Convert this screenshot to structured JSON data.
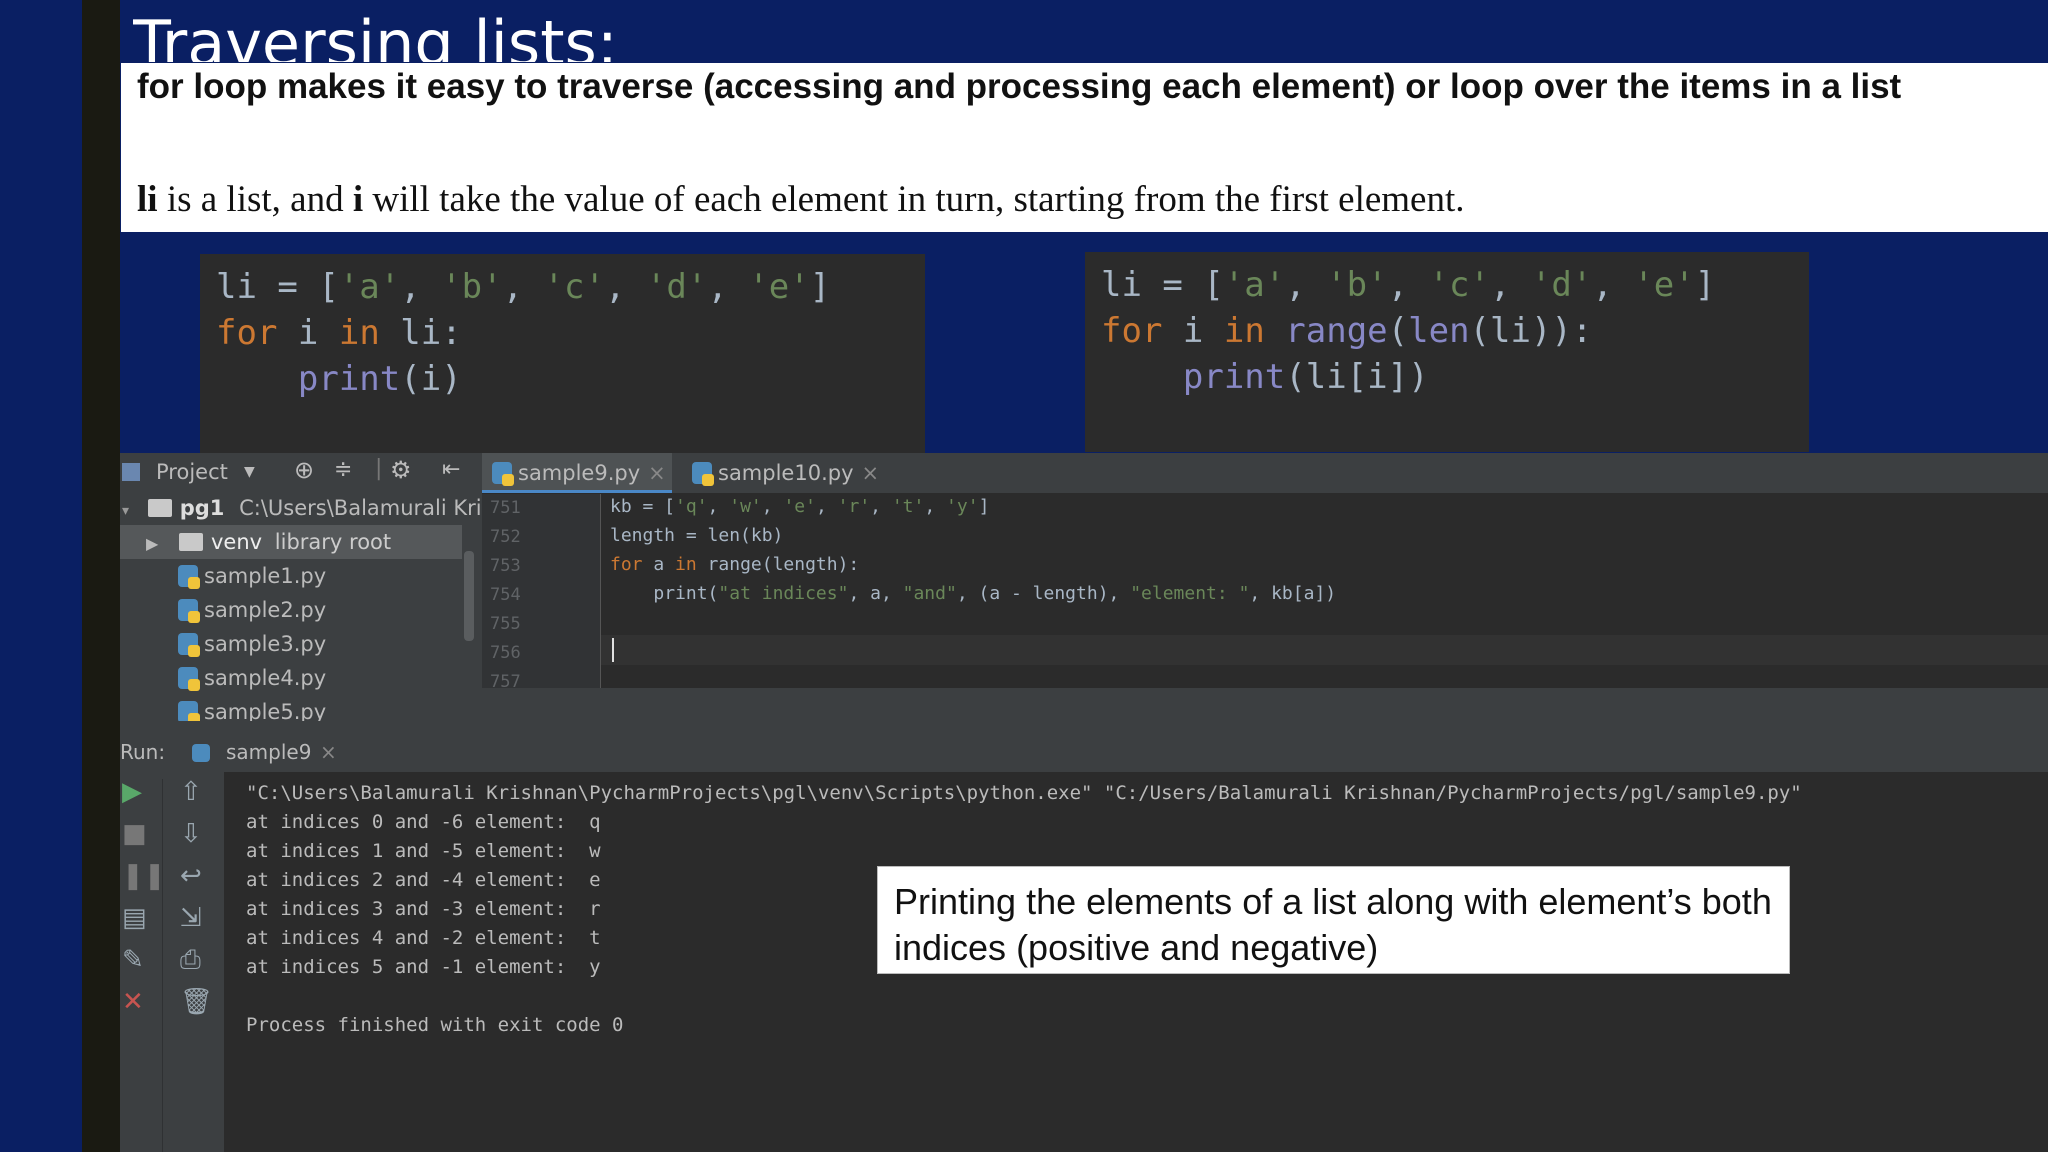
{
  "slide": {
    "title": "Traversing lists:",
    "intro": "for loop makes it easy to traverse (accessing and processing each element) or loop over the items in a list",
    "desc_li": "li",
    "desc_part1": " is a list, and ",
    "desc_i": "i",
    "desc_part2": " will take the value of each element in turn, starting from the first element.",
    "callout": " Printing the elements of a list along with element’s both indices (positive and negative)"
  },
  "code_left": {
    "line1": {
      "a": "li = [",
      "s1": "'a'",
      "c1": ", ",
      "s2": "'b'",
      "c2": ", ",
      "s3": "'c'",
      "c3": ", ",
      "s4": "'d'",
      "c4": ", ",
      "s5": "'e'",
      "end": "]"
    },
    "line2": {
      "kw1": "for",
      "mid": " i ",
      "kw2": "in",
      "end": " li:"
    },
    "line3": {
      "indent": "    ",
      "fn": "print",
      "end": "(i)"
    }
  },
  "code_right": {
    "line1": {
      "a": "li = [",
      "s1": "'a'",
      "c1": ", ",
      "s2": "'b'",
      "c2": ", ",
      "s3": "'c'",
      "c3": ", ",
      "s4": "'d'",
      "c4": ", ",
      "s5": "'e'",
      "end": "]"
    },
    "line2": {
      "kw1": "for",
      "mid": " i ",
      "kw2": "in",
      "sp": " ",
      "fn1": "range",
      "p1": "(",
      "fn2": "len",
      "end": "(li)):"
    },
    "line3": {
      "indent": "    ",
      "fn": "print",
      "end": "(li[i])"
    }
  },
  "ide": {
    "project_label": "Project",
    "tree": {
      "root_name": "pg1",
      "root_path": "C:\\Users\\Balamurali Krish",
      "venv_label": "venv",
      "venv_note": "library root",
      "files": [
        "sample1.py",
        "sample2.py",
        "sample3.py",
        "sample4.py",
        "sample5.py"
      ]
    },
    "tabs": [
      "sample9.py",
      "sample10.py"
    ],
    "line_numbers": [
      "751",
      "752",
      "753",
      "754",
      "755",
      "756",
      "757"
    ],
    "editor": {
      "l1": {
        "a": "kb = [",
        "s1": "'q'",
        "c1": ", ",
        "s2": "'w'",
        "c2": ", ",
        "s3": "'e'",
        "c3": ", ",
        "s4": "'r'",
        "c4": ", ",
        "s5": "'t'",
        "c5": ", ",
        "s6": "'y'",
        "end": "]"
      },
      "l2": "length = len(kb)",
      "l3": {
        "kw1": "for",
        "mid": " a ",
        "kw2": "in",
        "end": " range(length):"
      },
      "l4": {
        "indent": "    ",
        "fn": "print",
        "a": "(",
        "s1": "\"at indices\"",
        "b": ", a, ",
        "s2": "\"and\"",
        "c": ", (a - length), ",
        "s3": "\"element: \"",
        "end": ", kb[a])"
      }
    },
    "run_label": "Run:",
    "run_tab": "sample9",
    "console": [
      "\"C:\\Users\\Balamurali Krishnan\\PycharmProjects\\pgl\\venv\\Scripts\\python.exe\" \"C:/Users/Balamurali Krishnan/PycharmProjects/pgl/sample9.py\"",
      "at indices 0 and -6 element:  q",
      "at indices 1 and -5 element:  w",
      "at indices 2 and -4 element:  e",
      "at indices 3 and -3 element:  r",
      "at indices 4 and -2 element:  t",
      "at indices 5 and -1 element:  y",
      "",
      "Process finished with exit code 0"
    ]
  }
}
